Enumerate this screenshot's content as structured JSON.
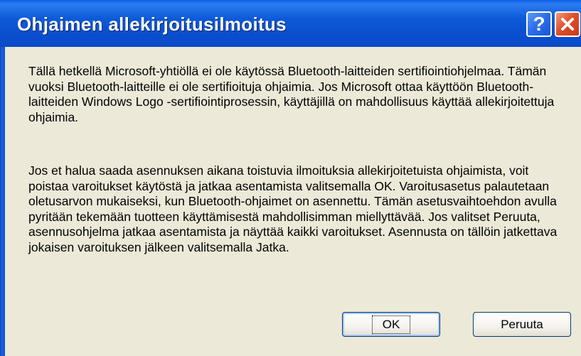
{
  "window": {
    "title": "Ohjaimen allekirjoitusilmoitus",
    "help_glyph": "?",
    "help_icon": "help-icon",
    "close_icon": "close-icon"
  },
  "message": {
    "paragraph1": "Tällä hetkellä Microsoft-yhtiöllä ei ole käytössä Bluetooth-laitteiden sertifiointiohjelmaa. Tämän vuoksi Bluetooth-laitteille ei ole sertifioituja ohjaimia.  Jos Microsoft ottaa käyttöön Bluetooth-laitteiden Windows Logo -sertifiointiprosessin, käyttäjillä on mahdollisuus käyttää allekirjoitettuja ohjaimia.",
    "paragraph2": "Jos et halua saada asennuksen aikana toistuvia ilmoituksia allekirjoitetuista ohjaimista, voit poistaa varoitukset käytöstä ja jatkaa asentamista valitsemalla OK. Varoitusasetus palautetaan oletusarvon mukaiseksi, kun Bluetooth-ohjaimet on asennettu. Tämän asetusvaihtoehdon avulla pyritään tekemään tuotteen käyttämisestä mahdollisimman miellyttävää. Jos valitset Peruuta, asennusohjelma jatkaa asentamista ja näyttää kaikki varoitukset. Asennusta on tällöin jatkettava jokaisen varoituksen jälkeen valitsemalla Jatka."
  },
  "buttons": {
    "ok_label": "OK",
    "cancel_label": "Peruuta"
  },
  "colors": {
    "titlebar": "#0b4ac8",
    "dialog_background": "#ece9d8",
    "close_button": "#e0502a"
  }
}
